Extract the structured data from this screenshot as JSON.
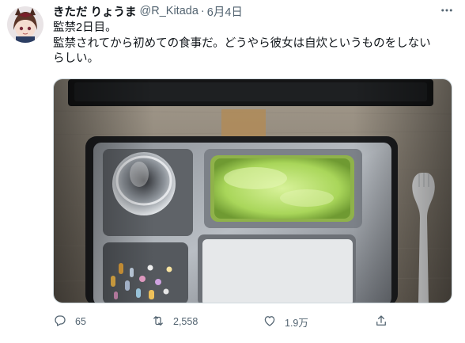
{
  "tweet": {
    "display_name": "きただ りょうま",
    "handle": "@R_Kitada",
    "separator": "·",
    "date": "6月4日",
    "text_lines": [
      "監禁2日目。",
      "監禁されてから初めての食事だ。どうやら彼女は自炊というものをしない",
      "らしい。"
    ]
  },
  "actions": {
    "reply_count": "65",
    "retweet_count": "2,558",
    "like_count": "1.9万"
  },
  "icons": {
    "more": "more-icon",
    "reply": "reply-icon",
    "retweet": "retweet-icon",
    "like": "like-icon",
    "share": "share-icon"
  },
  "colors": {
    "text": "#0f1419",
    "secondary": "#536471",
    "border": "#cfd9de"
  }
}
